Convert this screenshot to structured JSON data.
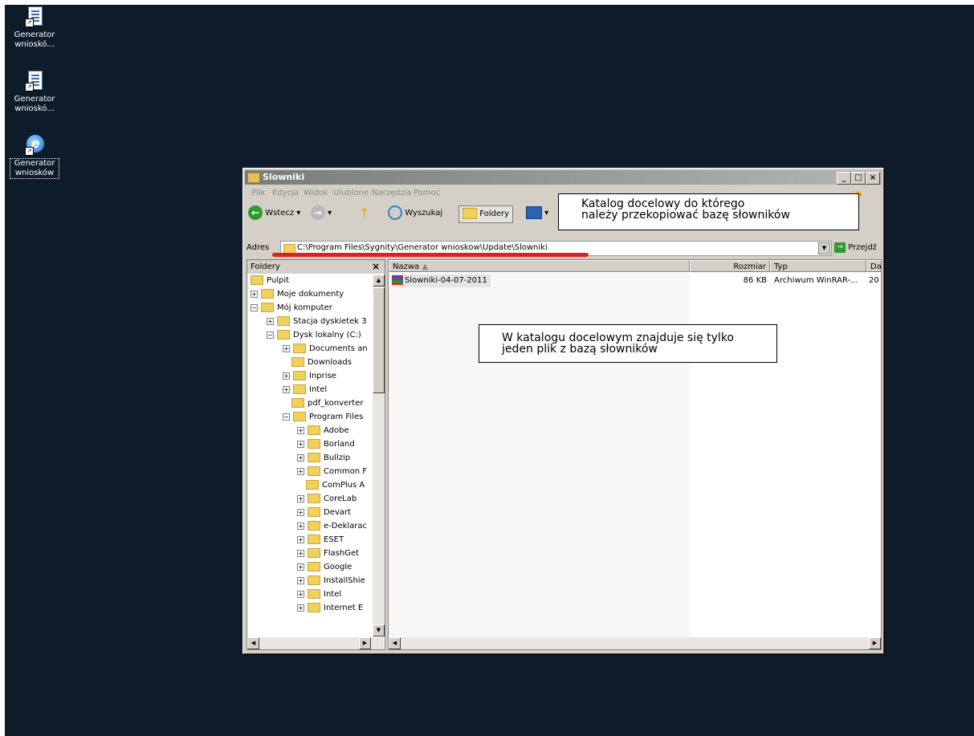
{
  "desktop": {
    "icons": [
      {
        "label": "Generator wnioskó...",
        "icon": "document-shortcut-icon"
      },
      {
        "label": "Generator wnioskó...",
        "icon": "document-shortcut-icon"
      },
      {
        "label": "Generator wniosków",
        "icon": "internet-explorer-icon"
      }
    ]
  },
  "window": {
    "title": "Slowniki",
    "buttons": {
      "minimize": "_",
      "maximize": "□",
      "close": "×"
    }
  },
  "menu": [
    "Plik",
    "Edycja",
    "Widok",
    "Ulubione",
    "Narzędzia",
    "Pomoc"
  ],
  "toolbar": {
    "back": "Wstecz",
    "search": "Wyszukaj",
    "folders": "Foldery"
  },
  "address": {
    "label": "Adres",
    "path": "C:\\Program Files\\Sygnity\\Generator wnioskow\\Update\\Slowniki",
    "go": "Przejdź"
  },
  "folders_panel": {
    "title": "Foldery",
    "close": "×"
  },
  "tree": [
    {
      "label": "Pulpit",
      "level": 0,
      "exp": ""
    },
    {
      "label": "Moje dokumenty",
      "level": 0,
      "exp": "+"
    },
    {
      "label": "Mój komputer",
      "level": 0,
      "exp": "−"
    },
    {
      "label": "Stacja dyskietek 3",
      "level": 1,
      "exp": "+"
    },
    {
      "label": "Dysk lokalny (C:)",
      "level": 1,
      "exp": "−"
    },
    {
      "label": "Documents an",
      "level": 2,
      "exp": "+"
    },
    {
      "label": "Downloads",
      "level": 2,
      "exp": ""
    },
    {
      "label": "Inprise",
      "level": 2,
      "exp": "+"
    },
    {
      "label": "Intel",
      "level": 2,
      "exp": "+"
    },
    {
      "label": "pdf_konverter",
      "level": 2,
      "exp": ""
    },
    {
      "label": "Program Files",
      "level": 2,
      "exp": "−"
    },
    {
      "label": "Adobe",
      "level": 3,
      "exp": "+"
    },
    {
      "label": "Borland",
      "level": 3,
      "exp": "+"
    },
    {
      "label": "Bullzip",
      "level": 3,
      "exp": "+"
    },
    {
      "label": "Common F",
      "level": 3,
      "exp": "+"
    },
    {
      "label": "ComPlus A",
      "level": 3,
      "exp": ""
    },
    {
      "label": "CoreLab",
      "level": 3,
      "exp": "+"
    },
    {
      "label": "Devart",
      "level": 3,
      "exp": "+"
    },
    {
      "label": "e-Deklarac",
      "level": 3,
      "exp": "+"
    },
    {
      "label": "ESET",
      "level": 3,
      "exp": "+"
    },
    {
      "label": "FlashGet",
      "level": 3,
      "exp": "+"
    },
    {
      "label": "Google",
      "level": 3,
      "exp": "+"
    },
    {
      "label": "InstallShie",
      "level": 3,
      "exp": "+"
    },
    {
      "label": "Intel",
      "level": 3,
      "exp": "+"
    },
    {
      "label": "Internet E",
      "level": 3,
      "exp": "+"
    }
  ],
  "columns": {
    "name": "Nazwa",
    "size": "Rozmiar",
    "type": "Typ",
    "date": "Da"
  },
  "files": [
    {
      "name": "Slowniki-04-07-2011",
      "size": "86 KB",
      "type": "Archiwum WinRAR-...",
      "date": "20"
    }
  ],
  "notes": {
    "target": [
      "Katalog docelowy do którego",
      "należy przekopiować bazę słowników"
    ],
    "onefile": [
      "W katalogu docelowym znajduje się tylko",
      "jeden plik z bazą słowników"
    ]
  }
}
